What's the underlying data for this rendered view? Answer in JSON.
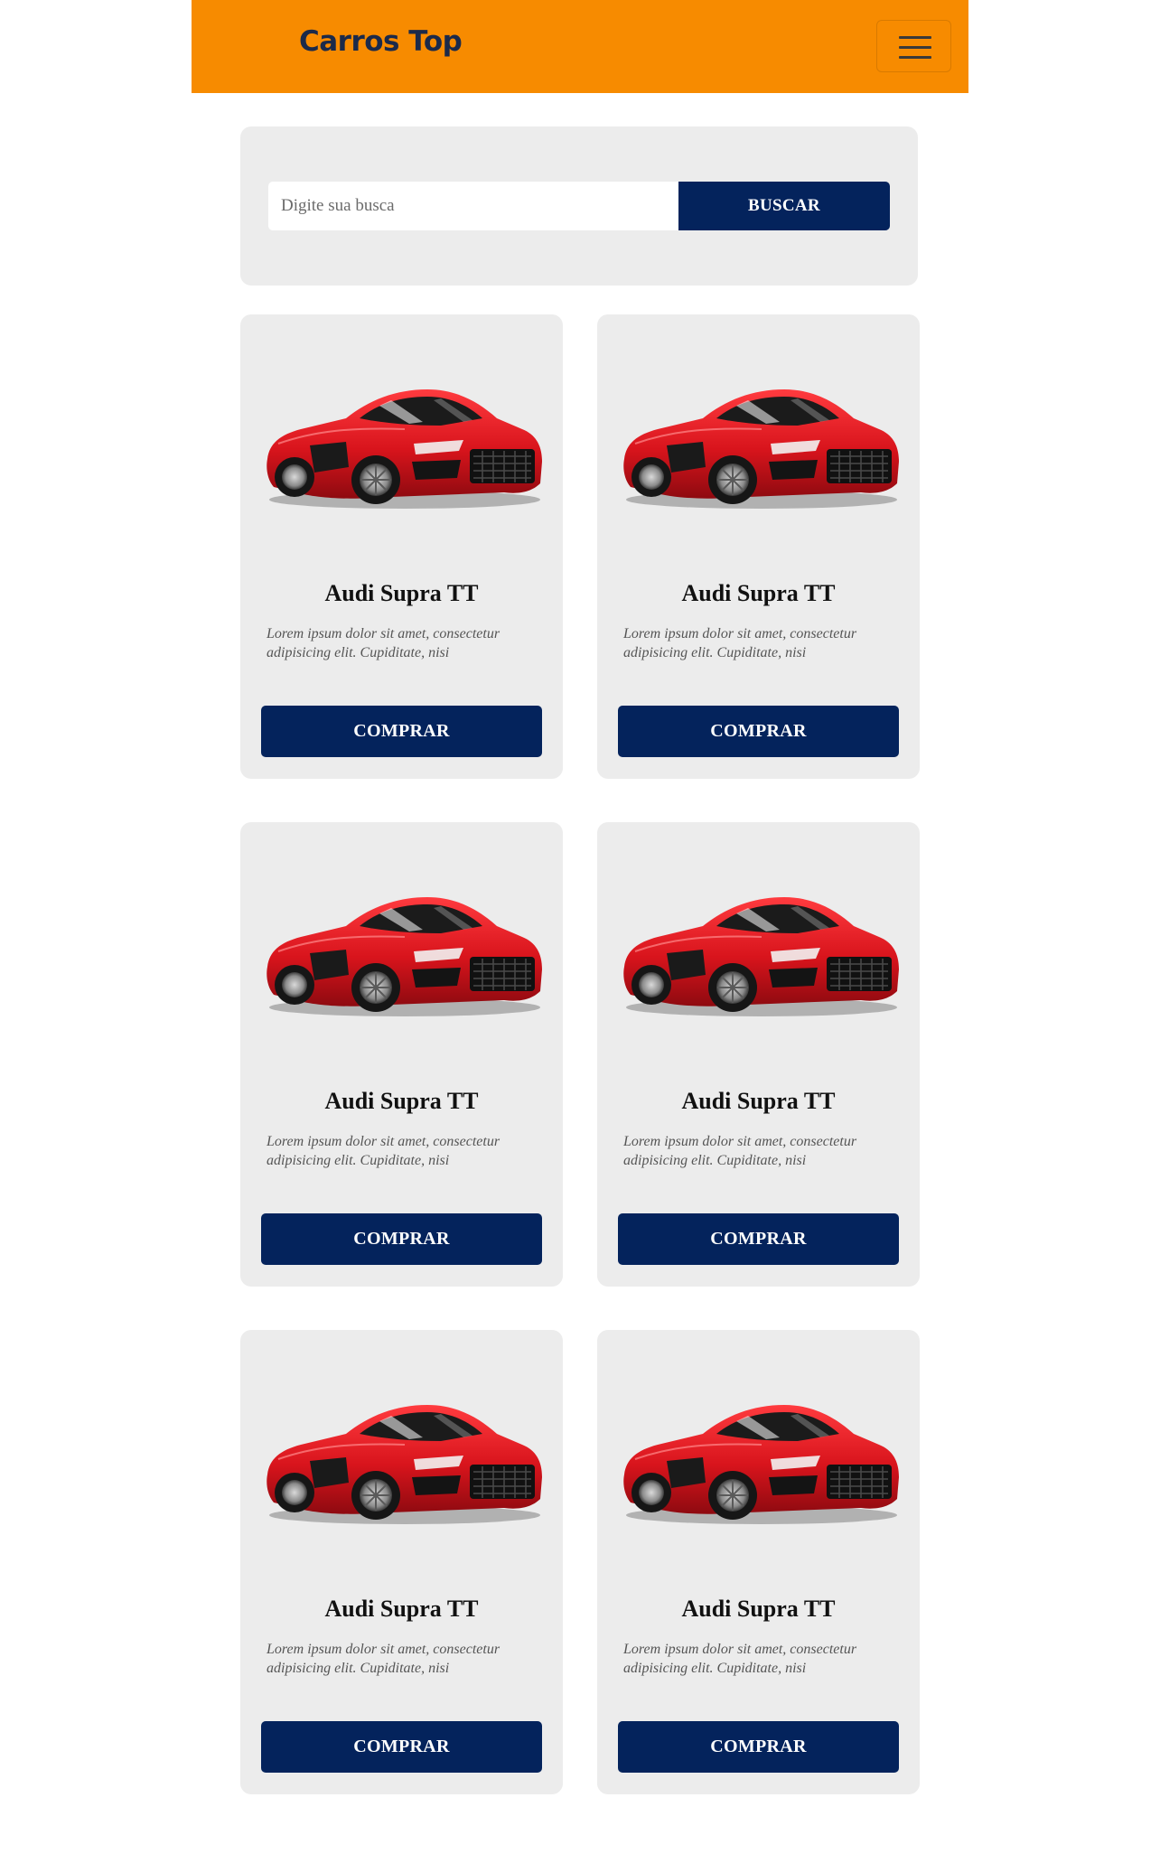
{
  "navbar": {
    "brand": "Carros Top",
    "menu_icon": "hamburger-menu-icon",
    "background_color": "#f78b00",
    "brand_color": "#1b2a4a"
  },
  "search": {
    "placeholder": "Digite sua busca",
    "value": "",
    "button_label": "BUSCAR",
    "button_color": "#04235c"
  },
  "products": [
    {
      "image": "red-sports-car-image",
      "title": "Audi Supra TT",
      "description": "Lorem ipsum dolor sit amet, consectetur adipisicing elit. Cupiditate, nisi",
      "button_label": "COMPRAR"
    },
    {
      "image": "red-sports-car-image",
      "title": "Audi Supra TT",
      "description": "Lorem ipsum dolor sit amet, consectetur adipisicing elit. Cupiditate, nisi",
      "button_label": "COMPRAR"
    },
    {
      "image": "red-sports-car-image",
      "title": "Audi Supra TT",
      "description": "Lorem ipsum dolor sit amet, consectetur adipisicing elit. Cupiditate, nisi",
      "button_label": "COMPRAR"
    },
    {
      "image": "red-sports-car-image",
      "title": "Audi Supra TT",
      "description": "Lorem ipsum dolor sit amet, consectetur adipisicing elit. Cupiditate, nisi",
      "button_label": "COMPRAR"
    },
    {
      "image": "red-sports-car-image",
      "title": "Audi Supra TT",
      "description": "Lorem ipsum dolor sit amet, consectetur adipisicing elit. Cupiditate, nisi",
      "button_label": "COMPRAR"
    },
    {
      "image": "red-sports-car-image",
      "title": "Audi Supra TT",
      "description": "Lorem ipsum dolor sit amet, consectetur adipisicing elit. Cupiditate, nisi",
      "button_label": "COMPRAR"
    }
  ],
  "colors": {
    "card_background": "#ececec",
    "car_red": "#d8141c"
  }
}
